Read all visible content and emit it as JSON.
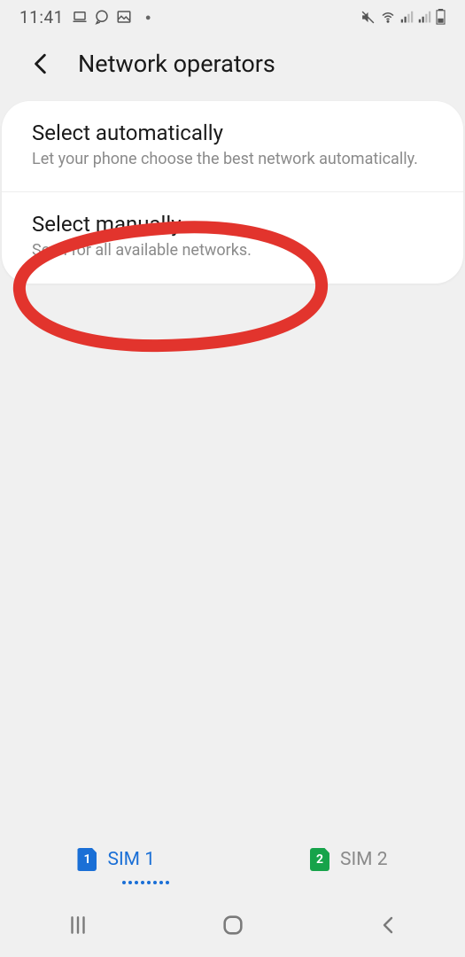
{
  "status": {
    "time": "11:41"
  },
  "header": {
    "title": "Network operators"
  },
  "options": {
    "auto": {
      "title": "Select automatically",
      "subtitle": "Let your phone choose the best network automatically."
    },
    "manual": {
      "title": "Select manually",
      "subtitle": "Scan for all available networks."
    }
  },
  "tabs": {
    "sim1": {
      "num": "1",
      "label": "SIM 1"
    },
    "sim2": {
      "num": "2",
      "label": "SIM 2"
    }
  }
}
